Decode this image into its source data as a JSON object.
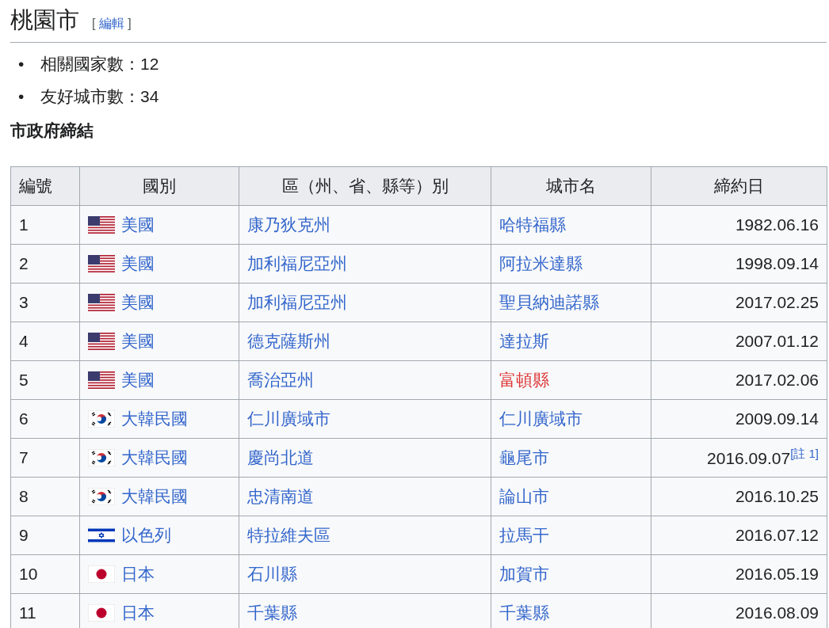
{
  "heading": {
    "title": "桃園市",
    "edit_open": "[",
    "edit_link": "編輯",
    "edit_close": "]"
  },
  "summary": [
    {
      "bullet": "•",
      "text": "相關國家數：12"
    },
    {
      "bullet": "•",
      "text": "友好城市數：34"
    }
  ],
  "section_title": "市政府締結",
  "table": {
    "columns": [
      "編號",
      "國別",
      "區（州、省、縣等）別",
      "城市名",
      "締約日"
    ],
    "rows": [
      {
        "no": "1",
        "country": {
          "kind": "us",
          "name": "美國"
        },
        "region": "康乃狄克州",
        "city": {
          "name": "哈特福縣",
          "missing": false
        },
        "date": "1982.06.16"
      },
      {
        "no": "2",
        "country": {
          "kind": "us",
          "name": "美國"
        },
        "region": "加利福尼亞州",
        "city": {
          "name": "阿拉米達縣",
          "missing": false
        },
        "date": "1998.09.14"
      },
      {
        "no": "3",
        "country": {
          "kind": "us",
          "name": "美國"
        },
        "region": "加利福尼亞州",
        "city": {
          "name": "聖貝納迪諾縣",
          "missing": false
        },
        "date": "2017.02.25"
      },
      {
        "no": "4",
        "country": {
          "kind": "us",
          "name": "美國"
        },
        "region": "德克薩斯州",
        "city": {
          "name": "達拉斯",
          "missing": false
        },
        "date": "2007.01.12"
      },
      {
        "no": "5",
        "country": {
          "kind": "us",
          "name": "美國"
        },
        "region": "喬治亞州",
        "city": {
          "name": "富頓縣",
          "missing": true
        },
        "date": "2017.02.06"
      },
      {
        "no": "6",
        "country": {
          "kind": "kr",
          "name": "大韓民國"
        },
        "region": "仁川廣域市",
        "city": {
          "name": "仁川廣域市",
          "missing": false
        },
        "date": "2009.09.14"
      },
      {
        "no": "7",
        "country": {
          "kind": "kr",
          "name": "大韓民國"
        },
        "region": "慶尚北道",
        "city": {
          "name": "龜尾市",
          "missing": false
        },
        "date": "2016.09.07",
        "note": "[註 1]"
      },
      {
        "no": "8",
        "country": {
          "kind": "kr",
          "name": "大韓民國"
        },
        "region": "忠清南道",
        "city": {
          "name": "論山市",
          "missing": false
        },
        "date": "2016.10.25"
      },
      {
        "no": "9",
        "country": {
          "kind": "il",
          "name": "以色列"
        },
        "region": "特拉維夫區",
        "city": {
          "name": "拉馬干",
          "missing": false
        },
        "date": "2016.07.12"
      },
      {
        "no": "10",
        "country": {
          "kind": "jp",
          "name": "日本"
        },
        "region": "石川縣",
        "city": {
          "name": "加賀市",
          "missing": false
        },
        "date": "2016.05.19"
      },
      {
        "no": "11",
        "country": {
          "kind": "jp",
          "name": "日本"
        },
        "region": "千葉縣",
        "city": {
          "name": "千葉縣",
          "missing": false
        },
        "date": "2016.08.09"
      }
    ]
  }
}
